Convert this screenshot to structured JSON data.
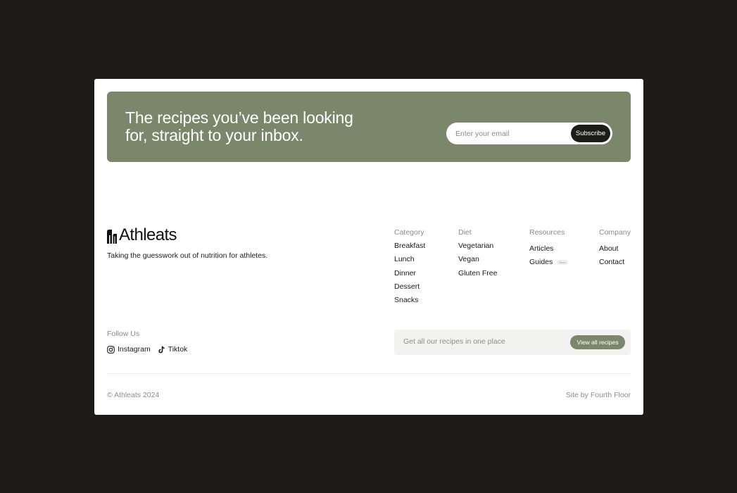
{
  "newsletter": {
    "title": "The recipes you’ve been looking for, straight to your inbox.",
    "email_placeholder": "Enter your email",
    "subscribe_label": "Subscribe"
  },
  "brand": {
    "name": "Athleats",
    "tagline": "Taking the guesswork out of nutrition for athletes."
  },
  "columns": {
    "category": {
      "heading": "Category",
      "items": [
        "Breakfast",
        "Lunch",
        "Dinner",
        "Dessert",
        "Snacks"
      ]
    },
    "diet": {
      "heading": "Diet",
      "items": [
        "Vegetarian",
        "Vegan",
        "Gluten Free"
      ]
    },
    "resources": {
      "heading": "Resources",
      "items": [
        "Articles",
        "Guides"
      ],
      "guides_badge": "Soon"
    },
    "company": {
      "heading": "Company",
      "items": [
        "About",
        "Contact"
      ]
    }
  },
  "social": {
    "heading": "Follow Us",
    "links": [
      {
        "label": "Instagram",
        "icon": "instagram-icon"
      },
      {
        "label": "Tiktok",
        "icon": "tiktok-icon"
      }
    ]
  },
  "cta": {
    "text": "Get all our recipes in one place",
    "button_label": "View all recipes"
  },
  "footer": {
    "copyright": "© Athleats 2024",
    "credit": "Site by Fourth Floor"
  },
  "colors": {
    "background": "#1d1c1a",
    "accent": "#7a876b",
    "button_dark": "#1c1c1a"
  }
}
